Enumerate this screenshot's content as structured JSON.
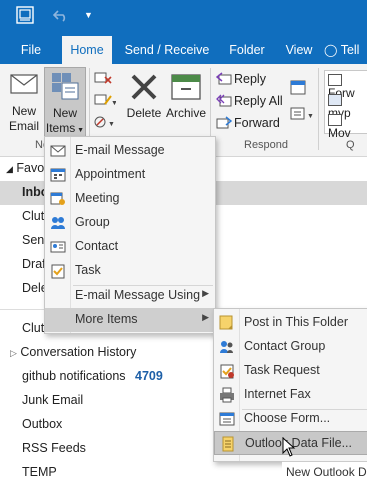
{
  "tabs": [
    "File",
    "Home",
    "Send / Receive",
    "Folder",
    "View",
    "Tell"
  ],
  "ribbon": {
    "new_email": [
      "New",
      "Email"
    ],
    "new_items": [
      "New",
      "Items"
    ],
    "delete": "Delete",
    "archive": "Archive",
    "reply": "Reply",
    "reply_all": "Reply All",
    "forward": "Forward",
    "respond_group": "Respond",
    "new_group": "Ne",
    "quick_group": "Q",
    "quick_steps": [
      "Forw",
      "myp",
      "Mov"
    ]
  },
  "folders": {
    "favorites": "Favo",
    "inbox": "Inbo",
    "clutter_fav": "Clutt",
    "sent": "Sent",
    "drafts": "Draf",
    "deleted": "Dele",
    "clutter": "Clutter",
    "conversation_history": "Conversation History",
    "github": "github notifications",
    "github_count": "4709",
    "junk": "Junk Email",
    "outbox": "Outbox",
    "rss": "RSS Feeds",
    "temp": "TEMP"
  },
  "new_items_menu": [
    {
      "label": "E-mail Message",
      "icon": "email-message-icon"
    },
    {
      "label": "Appointment",
      "icon": "appointment-icon"
    },
    {
      "label": "Meeting",
      "icon": "meeting-icon"
    },
    {
      "label": "Group",
      "icon": "group-icon"
    },
    {
      "label": "Contact",
      "icon": "contact-icon"
    },
    {
      "label": "Task",
      "icon": "task-icon"
    },
    {
      "label": "E-mail Message Using",
      "icon": ""
    },
    {
      "label": "More Items",
      "icon": ""
    }
  ],
  "more_items_menu": [
    {
      "label": "Post in This Folder",
      "icon": "post-icon"
    },
    {
      "label": "Contact Group",
      "icon": "contact-group-icon"
    },
    {
      "label": "Task Request",
      "icon": "task-request-icon"
    },
    {
      "label": "Internet Fax",
      "icon": "fax-icon"
    },
    {
      "label": "Choose Form...",
      "icon": "choose-form-icon"
    },
    {
      "label": "Outlook Data File...",
      "icon": "data-file-icon"
    }
  ],
  "footer_text": "New Outlook D"
}
